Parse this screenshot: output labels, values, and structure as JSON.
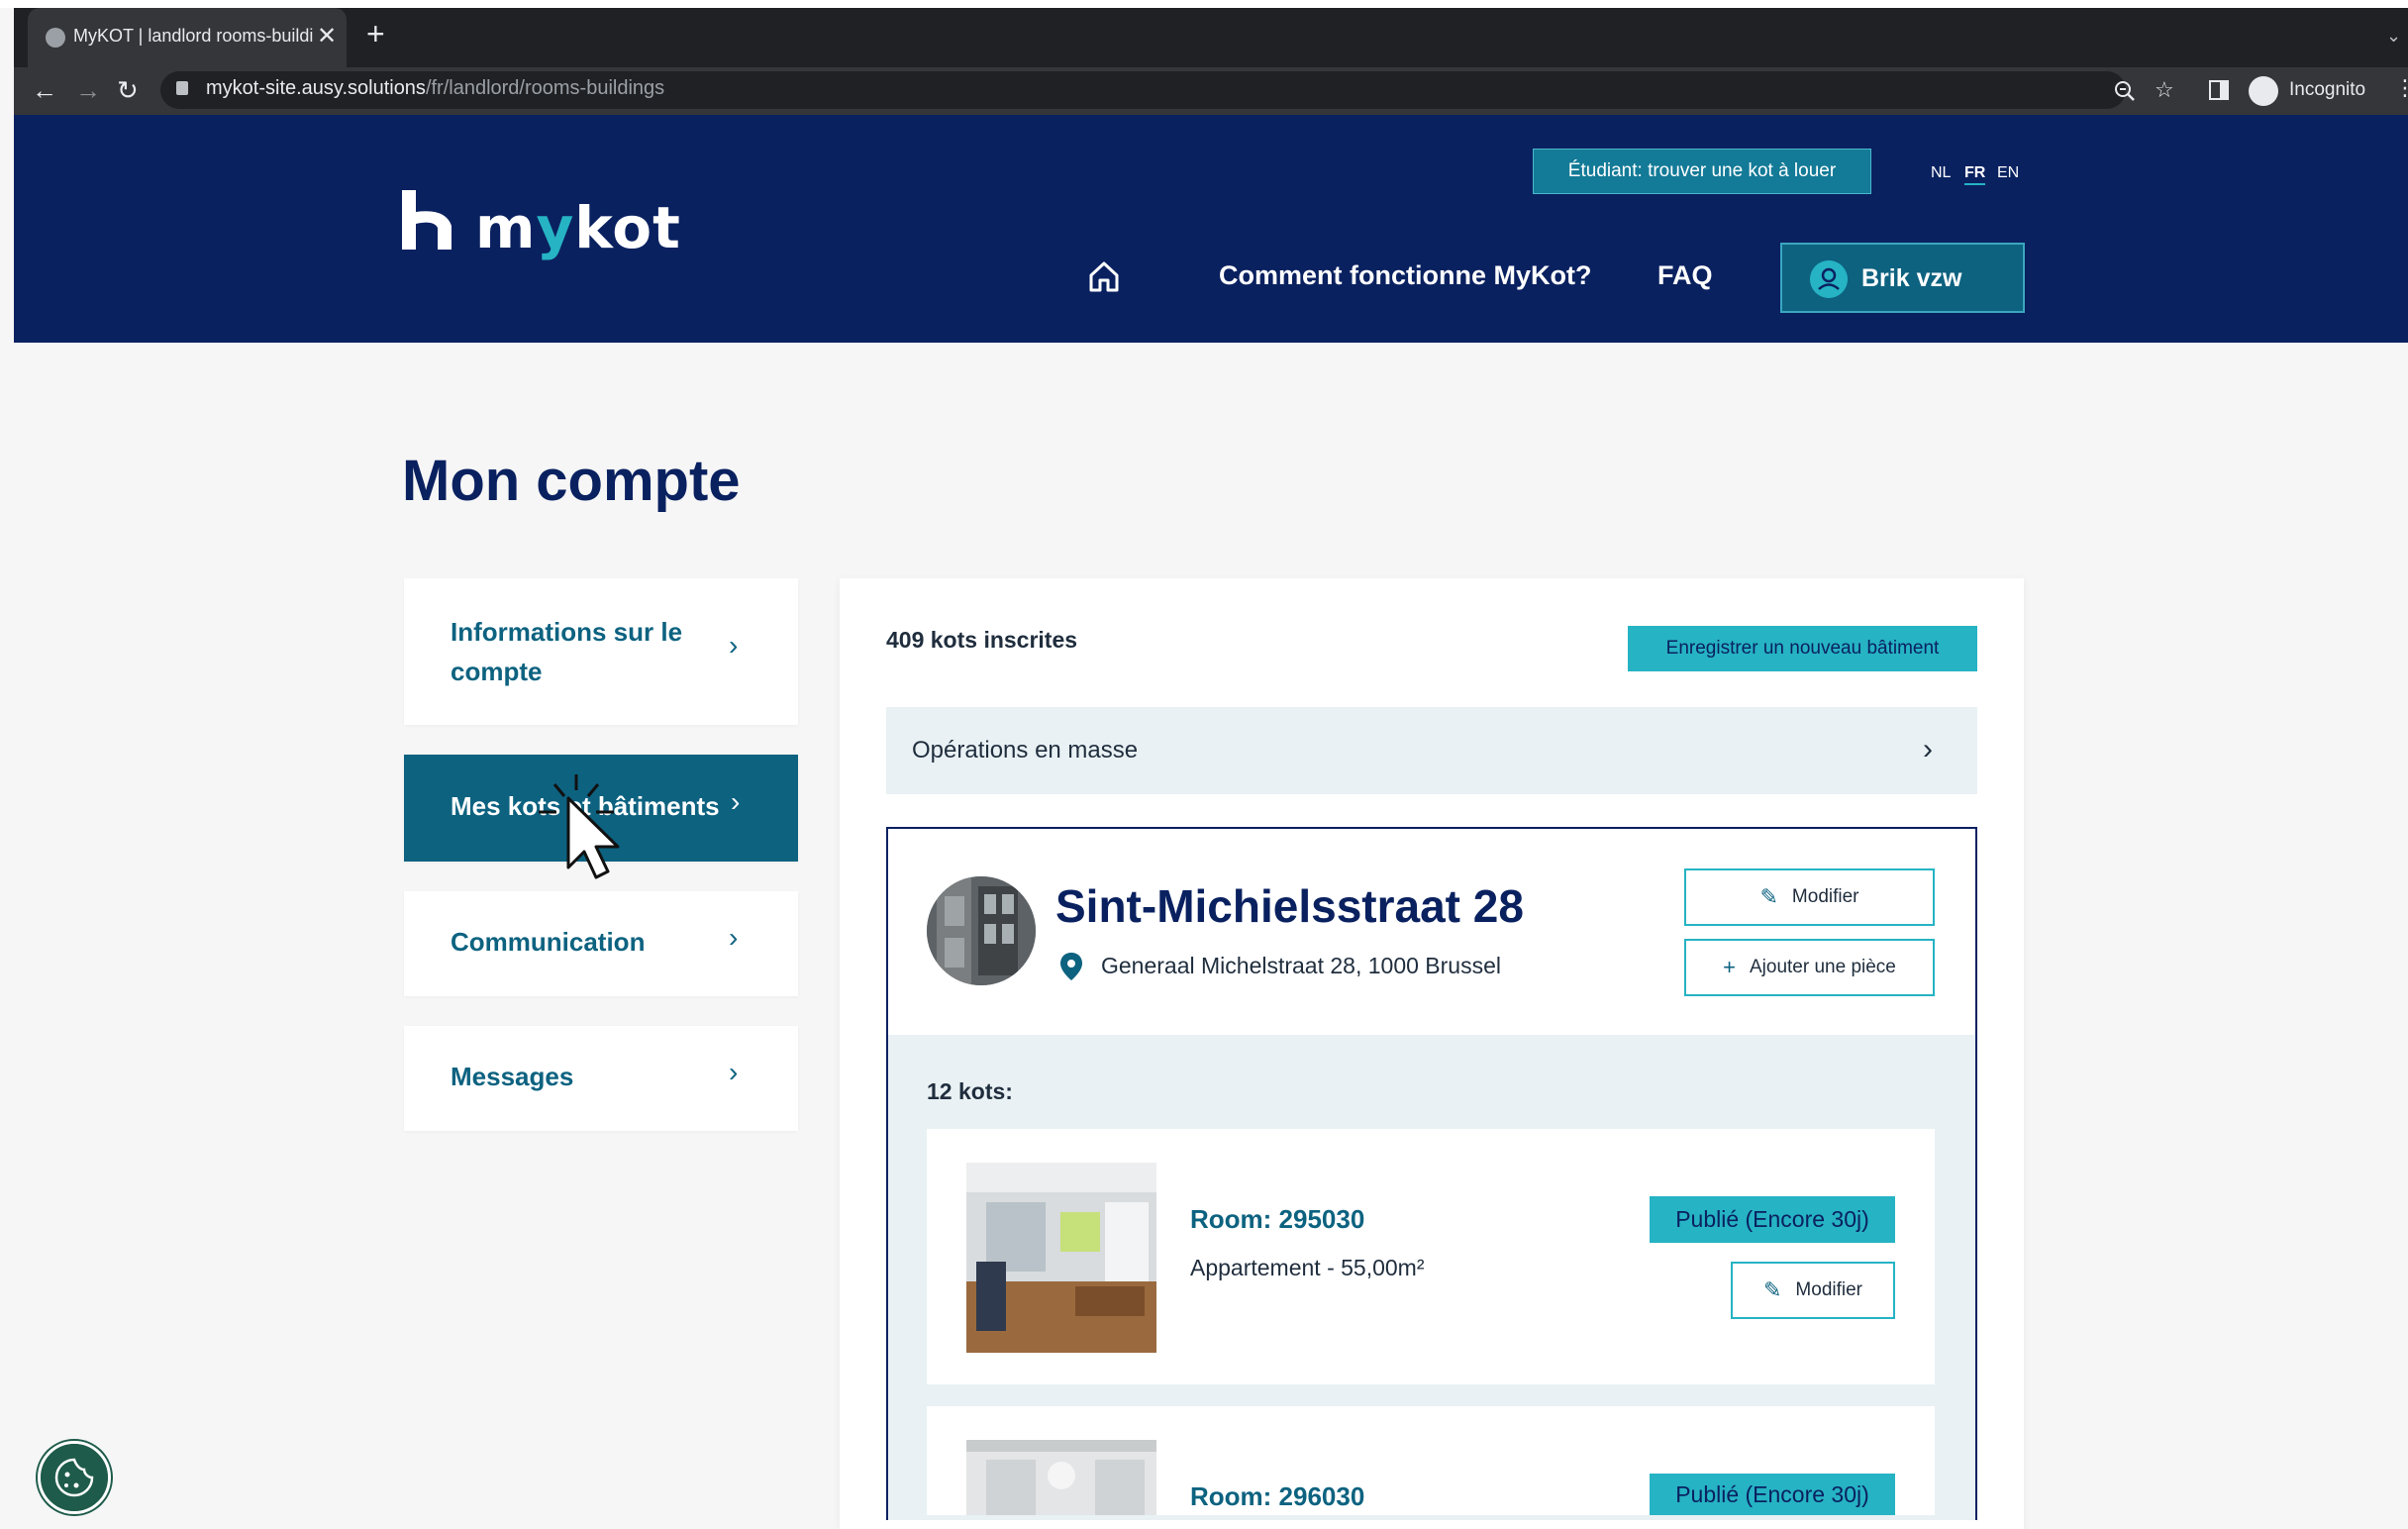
{
  "browser": {
    "tab_title": "MyKOT | landlord rooms-buildi",
    "tab_close": "✕",
    "new_tab": "+",
    "url_host": "mykot-site.ausy.solutions",
    "url_path": "/fr/landlord/rooms-buildings",
    "nav_back": "←",
    "nav_forward": "→",
    "nav_reload": "↻",
    "zoom_icon": "magnifier-icon",
    "star": "☆",
    "incognito_label": "Incognito",
    "menu": "⋮",
    "tab_menu": "⌄"
  },
  "header": {
    "logo_text_a": "m",
    "logo_text_y": "y",
    "logo_text_b": "kot",
    "student_button": "Étudiant: trouver une kot à louer",
    "languages": [
      "NL",
      "FR",
      "EN"
    ],
    "active_language": "FR",
    "nav_how": "Comment fonctionne MyKot?",
    "nav_faq": "FAQ",
    "user_name": "Brik vzw"
  },
  "page": {
    "title": "Mon compte"
  },
  "sidebar": {
    "items": [
      {
        "label_line1": "Informations sur le",
        "label_line2": "compte"
      },
      {
        "label": "Mes kots et bâtiments"
      },
      {
        "label": "Communication"
      },
      {
        "label": "Messages"
      }
    ],
    "chevron": "›",
    "active_index": 1
  },
  "main": {
    "count_text": "409 kots inscrites",
    "register_button": "Enregistrer un nouveau bâtiment",
    "bulk_label": "Opérations en masse",
    "bulk_chevron": "›",
    "building": {
      "name": "Sint-Michielsstraat 28",
      "address": "Generaal Michelstraat 28, 1000 Brussel",
      "edit_button": "Modifier",
      "add_room_button": "Ajouter une pièce",
      "edit_icon": "✎",
      "add_icon": "+",
      "rooms_count": "12 kots:"
    },
    "rooms": [
      {
        "name": "Room: 295030",
        "desc": "Appartement - 55,00m²",
        "status": "Publié (Encore 30j)",
        "edit": "Modifier"
      },
      {
        "name": "Room: 296030",
        "status": "Publié (Encore 30j)"
      }
    ]
  },
  "colors": {
    "navy": "#0a2160",
    "teal": "#26b3c4",
    "dark_teal": "#0d6280"
  }
}
